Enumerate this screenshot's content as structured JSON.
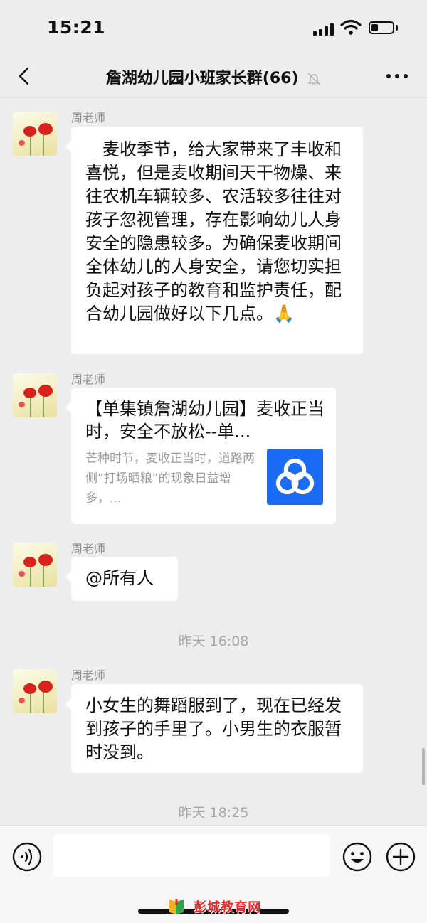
{
  "status_bar": {
    "time": "15:21"
  },
  "nav": {
    "title": "詹湖幼儿园小班家长群(66)"
  },
  "messages": [
    {
      "sender": "周老师",
      "text": "　麦收季节，给大家带来了丰收和喜悦，但是麦收期间天干物燥、来往农机车辆较多、农活较多往往对孩子忽视管理，存在影响幼儿人身安全的隐患较多。为确保麦收期间全体幼儿的人身安全，请您切实担负起对孩子的教育和监护责任，配合幼儿园做好以下几点。🙏"
    },
    {
      "sender": "周老师",
      "link_title": "【单集镇詹湖幼儿园】麦收正当时，安全不放松--单...",
      "link_desc": "芒种时节，麦收正当时，道路两侧“打场晒粮”的现象日益增多，..."
    },
    {
      "sender": "周老师",
      "text": "@所有人"
    },
    {
      "sender": "周老师",
      "text": "小女生的舞蹈服到了，现在已经发到孩子的手里了。小男生的衣服暂时没到。"
    }
  ],
  "timestamps": [
    "昨天 16:08",
    "昨天 18:25"
  ],
  "input": {
    "placeholder": ""
  },
  "watermark": "彭城教育网",
  "icons": {
    "back": "chevron-left-icon",
    "mute": "bell-off-icon",
    "more": "more-dots-icon",
    "voice": "voice-icon",
    "emoji": "emoji-icon",
    "plus": "plus-icon",
    "link_logo": "app-logo-icon"
  },
  "colors": {
    "background": "#ededed",
    "bubble": "#ffffff",
    "link_logo": "#1a6cf5",
    "watermark": "#e02a2a"
  }
}
